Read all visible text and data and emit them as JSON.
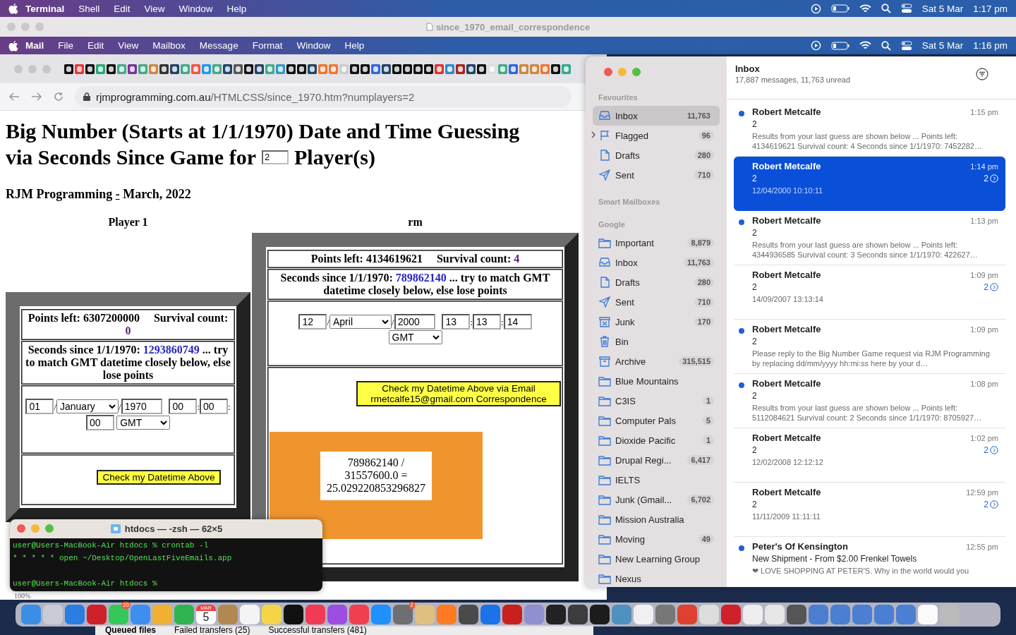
{
  "menu_bar": {
    "app": "Terminal",
    "menus": [
      "Shell",
      "Edit",
      "View",
      "Window",
      "Help"
    ],
    "date": "Sat 5 Mar",
    "time": "1:17 pm"
  },
  "terminal_window_title": "since_1970_email_correspondence",
  "mail_menu_bar": {
    "app": "Mail",
    "menus": [
      "File",
      "Edit",
      "View",
      "Mailbox",
      "Message",
      "Format",
      "Window",
      "Help"
    ],
    "date": "Sat 5 Mar",
    "time": "1:16 pm"
  },
  "browser": {
    "address_host": "rjmprogramming.com.au",
    "address_path": "/HTMLCSS/since_1970.htm?numplayers=2",
    "zoom": "100%",
    "page": {
      "title_line1": "Big Number (Starts at 1/1/1970) Date and Time Guessing",
      "title_before": "via Seconds Since Game for",
      "num_players": "2",
      "title_after": "Player(s)",
      "byline": "RJM Programming",
      "byline_link": "-",
      "byline_date": "March, 2022",
      "players": [
        {
          "heading": "Player 1",
          "points": "Points left: 6307200000",
          "survival_label": "Survival count:",
          "survival_count": "0",
          "seconds_label": "Seconds since 1/1/1970:",
          "seconds": "1293860749",
          "seconds_note": "... try to match GMT datetime closely below, else lose points",
          "day": "01",
          "month": "January",
          "year": "1970",
          "hour": "00",
          "minute": "00",
          "second": "00",
          "timezone": "GMT",
          "separators": [
            "/",
            "/",
            ":",
            ":"
          ],
          "button": "Check my Datetime Above"
        },
        {
          "heading": "rm",
          "points": "Points left: 4134619621",
          "survival_label": "Survival count:",
          "survival_count": "4",
          "seconds_label": "Seconds since 1/1/1970:",
          "seconds": "789862140",
          "seconds_note": "... try to match GMT datetime closely below, else lose points",
          "day": "12",
          "month": "April",
          "year": "2000",
          "hour": "13",
          "minute": "13",
          "second": "14",
          "timezone": "GMT",
          "separators": [
            "/",
            "/",
            ":",
            ":"
          ],
          "button": "Check my Datetime Above via Email rmetcalfe15@gmail.com Correspondence",
          "result_lines": [
            "789862140 /",
            "31557600.0 =",
            "25.029220853296827"
          ]
        }
      ]
    }
  },
  "mail": {
    "sidebar": [
      {
        "title": "Favourites",
        "items": [
          {
            "kind": "inbox",
            "label": "Inbox",
            "count": "11,763",
            "selected": true
          },
          {
            "kind": "flag",
            "label": "Flagged",
            "count": "96",
            "selected": false,
            "expanded": false
          },
          {
            "kind": "doc",
            "label": "Drafts",
            "count": "280",
            "selected": false
          },
          {
            "kind": "sent",
            "label": "Sent",
            "count": "710",
            "selected": false
          }
        ]
      },
      {
        "title": "Smart Mailboxes"
      },
      {
        "title": "Google",
        "items": [
          {
            "kind": "folder",
            "label": "Important",
            "count": "8,879",
            "selected": false
          },
          {
            "kind": "inbox",
            "label": "Inbox",
            "count": "11,763",
            "selected": false
          },
          {
            "kind": "doc",
            "label": "Drafts",
            "count": "280",
            "selected": false
          },
          {
            "kind": "sent",
            "label": "Sent",
            "count": "710",
            "selected": false
          },
          {
            "kind": "junk",
            "label": "Junk",
            "count": "170",
            "selected": false
          },
          {
            "kind": "bin",
            "label": "Bin",
            "selected": false
          },
          {
            "kind": "archive",
            "label": "Archive",
            "count": "315,515",
            "selected": false
          },
          {
            "kind": "folder",
            "label": "Blue Mountains",
            "selected": false
          },
          {
            "kind": "folder",
            "label": "C3IS",
            "count": "1",
            "selected": false
          },
          {
            "kind": "folder",
            "label": "Computer Pals",
            "count": "5",
            "selected": false
          },
          {
            "kind": "folder",
            "label": "Dioxide Pacific",
            "count": "1",
            "selected": false
          },
          {
            "kind": "folder",
            "label": "Drupal Regi...",
            "count": "6,417",
            "selected": false
          },
          {
            "kind": "folder",
            "label": "IELTS",
            "selected": false
          },
          {
            "kind": "folder",
            "label": "Junk (Gmail...",
            "count": "6,702",
            "selected": false
          },
          {
            "kind": "folder",
            "label": "Mission Australia",
            "selected": false
          },
          {
            "kind": "folder",
            "label": "Moving",
            "count": "49",
            "selected": false
          },
          {
            "kind": "folder",
            "label": "New Learning Group",
            "selected": false
          },
          {
            "kind": "folder",
            "label": "Nexus",
            "selected": false
          }
        ]
      }
    ],
    "mailbox_title": "Inbox",
    "mailbox_summary": "17,887 messages, 11,763 unread",
    "messages": [
      {
        "sender": "Robert Metcalfe",
        "time": "1:15 pm",
        "subject": "2",
        "preview": "Results from your last guess are shown below ... Points left: 4134619621 Survival count: 4 Seconds since 1/1/1970: 7452282…",
        "unread": true,
        "selected": false
      },
      {
        "sender": "Robert Metcalfe",
        "time": "1:14 pm",
        "subject": "2",
        "preview": "12/04/2000 10:10:11",
        "thread": "2",
        "unread": false,
        "selected": true
      },
      {
        "sender": "Robert Metcalfe",
        "time": "1:13 pm",
        "subject": "2",
        "preview": "Results from your last guess are shown below ... Points left: 4344936585 Survival count: 3 Seconds since 1/1/1970: 422627…",
        "unread": true,
        "selected": false
      },
      {
        "sender": "Robert Metcalfe",
        "time": "1:09 pm",
        "subject": "2",
        "preview": "14/09/2007 13:13:14",
        "thread": "2",
        "unread": false,
        "selected": false
      },
      {
        "sender": "Robert Metcalfe",
        "time": "1:09 pm",
        "subject": "2",
        "preview": "Please reply to the Big Number Game request via RJM Programming by replacing dd/mm/yyyy hh:mi:ss here by your d…",
        "unread": true,
        "selected": false
      },
      {
        "sender": "Robert Metcalfe",
        "time": "1:08 pm",
        "subject": "2",
        "preview": "Results from your last guess are shown below ... Points left: 5112084621 Survival count: 2 Seconds since 1/1/1970: 8705927…",
        "unread": true,
        "selected": false
      },
      {
        "sender": "Robert Metcalfe",
        "time": "1:02 pm",
        "subject": "2",
        "preview": "12/02/2008 12:12:12",
        "thread": "2",
        "unread": false,
        "selected": false
      },
      {
        "sender": "Robert Metcalfe",
        "time": "12:59 pm",
        "subject": "2",
        "preview": "11/11/2009 11:11:11",
        "thread": "2",
        "unread": false,
        "selected": false
      },
      {
        "sender": "Peter's Of Kensington",
        "time": "12:55 pm",
        "subject": "New Shipment - From $2.00 Frenkel Towels",
        "preview": "❤ LOVE SHOPPING AT PETER'S. Why in the world would you",
        "unread": true,
        "selected": false
      }
    ]
  },
  "terminal": {
    "title": "htdocs — -zsh — 62×5",
    "lines": [
      "user@Users-MacBook-Air htdocs % crontab -l",
      "* * * * * open ~/Desktop/OpenLastFiveEmails.app"
    ],
    "prompt": "user@Users-MacBook-Air htdocs %"
  },
  "dock": [
    {
      "kind": "app",
      "color": "#3a8ee6"
    },
    {
      "kind": "app",
      "color": "#c9cbd6"
    },
    {
      "kind": "app",
      "color": "#2a7de1"
    },
    {
      "kind": "app",
      "color": "#d0202a"
    },
    {
      "kind": "app",
      "color": "#35c759",
      "badge": "20"
    },
    {
      "kind": "app",
      "color": "#3d8ef0"
    },
    {
      "kind": "app",
      "color": "#f0b030"
    },
    {
      "kind": "app",
      "color": "#2fb44f"
    },
    {
      "kind": "calendar",
      "color": "#f04040",
      "month": "MAR",
      "day": "5"
    },
    {
      "kind": "app",
      "color": "#b08850"
    },
    {
      "kind": "app",
      "color": "#f4f4f4"
    },
    {
      "kind": "app",
      "color": "#f5d547"
    },
    {
      "kind": "app",
      "color": "#111111"
    },
    {
      "kind": "app",
      "color": "#f23a55"
    },
    {
      "kind": "app",
      "color": "#9b4ee0"
    },
    {
      "kind": "app",
      "color": "#f04050"
    },
    {
      "kind": "app",
      "color": "#1e90ff"
    },
    {
      "kind": "app",
      "color": "#6e6e73",
      "badge": "2"
    },
    {
      "kind": "app",
      "color": "#e0c080"
    },
    {
      "kind": "app",
      "color": "#ff7a20"
    },
    {
      "kind": "app",
      "color": "#4a4a4a"
    },
    {
      "kind": "app",
      "color": "#1a73e8"
    },
    {
      "kind": "app",
      "color": "#c8201e"
    },
    {
      "kind": "app",
      "color": "#9090d0"
    },
    {
      "kind": "app",
      "color": "#222222"
    },
    {
      "kind": "app",
      "color": "#3c3c3c"
    },
    {
      "kind": "app",
      "color": "#1c1c1c"
    },
    {
      "kind": "app",
      "color": "#5090c0"
    },
    {
      "kind": "app",
      "color": "#f0f0f0"
    },
    {
      "kind": "app",
      "color": "#777777"
    },
    {
      "kind": "app",
      "color": "#e04030"
    },
    {
      "kind": "app",
      "color": "#dddddd"
    },
    {
      "kind": "app",
      "color": "#d0202a"
    },
    {
      "kind": "app",
      "color": "#eeeeee"
    },
    {
      "kind": "app",
      "color": "#e6e6e6"
    },
    {
      "kind": "app",
      "color": "#555555"
    },
    {
      "kind": "app",
      "color": "#4a7fd0"
    },
    {
      "kind": "app",
      "color": "#4a7fd1"
    },
    {
      "kind": "app",
      "color": "#4a7fd2"
    },
    {
      "kind": "app",
      "color": "#4a7fd3"
    },
    {
      "kind": "app",
      "color": "#4a7fd4"
    },
    {
      "kind": "app",
      "color": "#fafafa"
    },
    {
      "kind": "app",
      "color": "#bbbbbb"
    }
  ],
  "ftp_tabs": [
    "Queued files",
    "Failed transfers (25)",
    "Successful transfers (481)"
  ]
}
